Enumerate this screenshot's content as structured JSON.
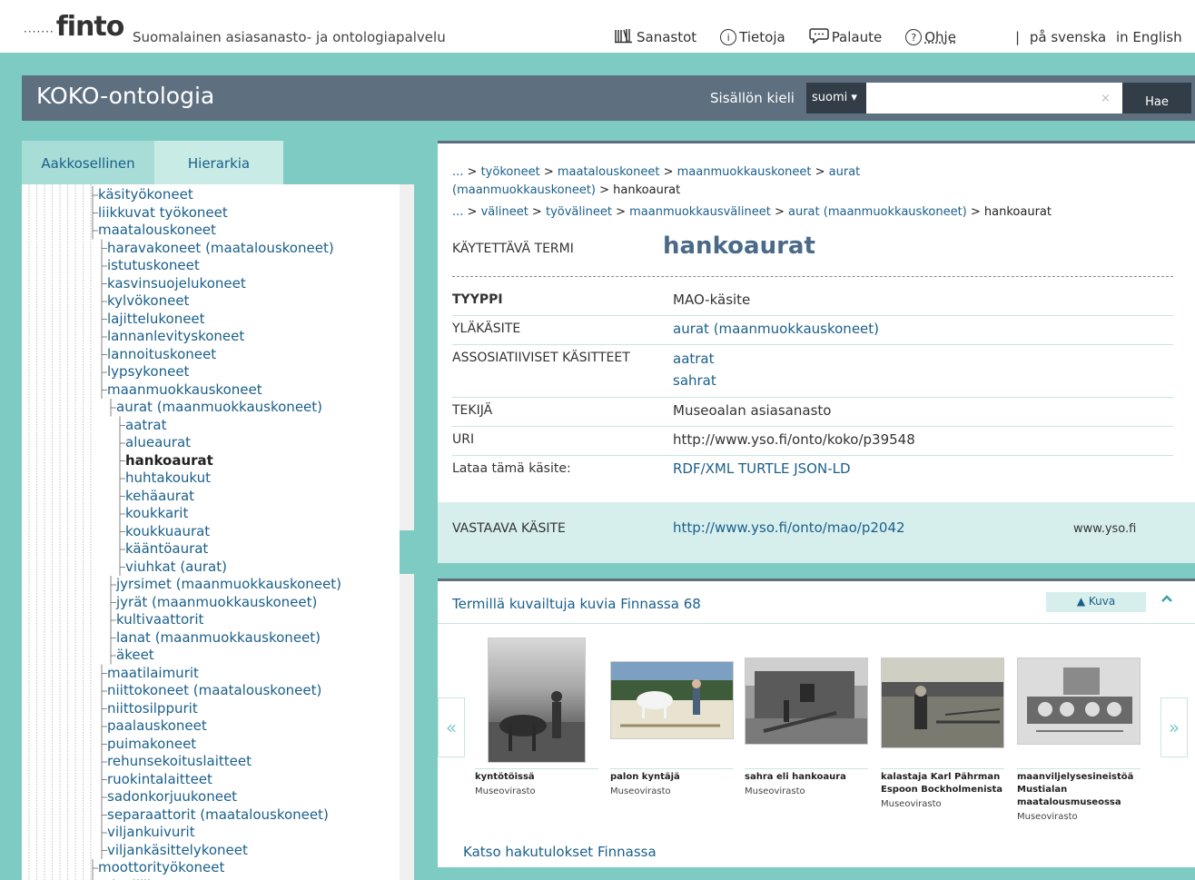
{
  "header": {
    "logo_dots": "·······",
    "logo_word": "finto",
    "tagline": "Suomalainen asiasanasto- ja ontologiapalvelu",
    "nav": [
      {
        "label": "Sanastot",
        "icon": "books-icon"
      },
      {
        "label": "Tietoja",
        "icon": "info-icon"
      },
      {
        "label": "Palaute",
        "icon": "speech-bubble-icon"
      },
      {
        "label": "Ohje",
        "icon": "question-icon"
      }
    ],
    "lang_separator": "|",
    "lang_sv": "på svenska",
    "lang_en": "in English"
  },
  "vocab_bar": {
    "title": "KOKO-ontologia",
    "content_lang_label": "Sisällön kieli",
    "content_lang_value": "suomi ▾",
    "search_value": "",
    "search_clear": "×",
    "search_button": "Hae"
  },
  "sidebar": {
    "tabs": [
      "Aakkosellinen",
      "Hierarkia"
    ],
    "active_tab": "Hierarkia",
    "tree": [
      {
        "label": "käsityökoneet",
        "depth": 0
      },
      {
        "label": "liikkuvat työkoneet",
        "depth": 0
      },
      {
        "label": "maatalouskoneet",
        "depth": 0
      },
      {
        "label": "haravakoneet (maatalouskoneet)",
        "depth": 1
      },
      {
        "label": "istutuskoneet",
        "depth": 1
      },
      {
        "label": "kasvinsuojelukoneet",
        "depth": 1
      },
      {
        "label": "kylvökoneet",
        "depth": 1
      },
      {
        "label": "lajittelukoneet",
        "depth": 1
      },
      {
        "label": "lannanlevityskoneet",
        "depth": 1
      },
      {
        "label": "lannoituskoneet",
        "depth": 1
      },
      {
        "label": "lypsykoneet",
        "depth": 1
      },
      {
        "label": "maanmuokkauskoneet",
        "depth": 1
      },
      {
        "label": "aurat (maanmuokkauskoneet)",
        "depth": 2
      },
      {
        "label": "aatrat",
        "depth": 3
      },
      {
        "label": "alueaurat",
        "depth": 3
      },
      {
        "label": "hankoaurat",
        "depth": 3,
        "current": true
      },
      {
        "label": "huhtakoukut",
        "depth": 3
      },
      {
        "label": "kehäaurat",
        "depth": 3
      },
      {
        "label": "koukkarit",
        "depth": 3
      },
      {
        "label": "koukkuaurat",
        "depth": 3
      },
      {
        "label": "kääntöaurat",
        "depth": 3
      },
      {
        "label": "viuhkat (aurat)",
        "depth": 3
      },
      {
        "label": "jyrsimet (maanmuokkauskoneet)",
        "depth": 2
      },
      {
        "label": "jyrät (maanmuokkauskoneet)",
        "depth": 2
      },
      {
        "label": "kultivaattorit",
        "depth": 2
      },
      {
        "label": "lanat (maanmuokkauskoneet)",
        "depth": 2
      },
      {
        "label": "äkeet",
        "depth": 2
      },
      {
        "label": "maatilaimurit",
        "depth": 1
      },
      {
        "label": "niittokoneet (maatalouskoneet)",
        "depth": 1
      },
      {
        "label": "niittosilppurit",
        "depth": 1
      },
      {
        "label": "paalauskoneet",
        "depth": 1
      },
      {
        "label": "puimakoneet",
        "depth": 1
      },
      {
        "label": "rehunsekoituslaitteet",
        "depth": 1
      },
      {
        "label": "ruokintalaitteet",
        "depth": 1
      },
      {
        "label": "sadonkorjuukoneet",
        "depth": 1
      },
      {
        "label": "separaattorit (maatalouskoneet)",
        "depth": 1
      },
      {
        "label": "viljankuivurit",
        "depth": 1
      },
      {
        "label": "viljankäsittelykoneet",
        "depth": 1
      },
      {
        "label": "moottorityökoneet",
        "depth": 0
      },
      {
        "label": "tekstiilikoneet",
        "depth": 0
      }
    ]
  },
  "concept": {
    "breadcrumb1": [
      {
        "label": "...",
        "link": true
      },
      {
        "label": "työkoneet",
        "link": true
      },
      {
        "label": "maatalouskoneet",
        "link": true
      },
      {
        "label": "maanmuokkauskoneet",
        "link": true
      },
      {
        "label": "aurat (maanmuokkauskoneet)",
        "link": true
      },
      {
        "label": "hankoaurat",
        "link": false
      }
    ],
    "breadcrumb2": [
      {
        "label": "...",
        "link": true
      },
      {
        "label": "välineet",
        "link": true
      },
      {
        "label": "työvälineet",
        "link": true
      },
      {
        "label": "maanmuokkausvälineet",
        "link": true
      },
      {
        "label": "aurat (maanmuokkauskoneet)",
        "link": true
      },
      {
        "label": "hankoaurat",
        "link": false
      }
    ],
    "pref_label_title": "KÄYTETTÄVÄ TERMI",
    "pref_label": "hankoaurat",
    "props": {
      "type_label": "TYYPPI",
      "type_value": "MAO-käsite",
      "broader_label": "YLÄKÄSITE",
      "broader_value": "aurat (maanmuokkauskoneet)",
      "related_label": "ASSOSIATIIVISET KÄSITTEET",
      "related_1": "aatrat",
      "related_2": "sahrat",
      "creator_label": "TEKIJÄ",
      "creator_value": "Museoalan asiasanasto",
      "uri_label": "URI",
      "uri_value": "http://www.yso.fi/onto/koko/p39548",
      "download_label": "Lataa tämä käsite:",
      "download_value": "RDF/XML TURTLE JSON-LD"
    },
    "mapping": {
      "label": "VASTAAVA KÄSITE",
      "uri": "http://www.yso.fi/onto/mao/p2042",
      "site": "www.yso.fi"
    }
  },
  "finna": {
    "heading": "Termillä kuvailtuja kuvia Finnassa 68",
    "kuva_button": "▲ Kuva",
    "collapse_icon": "^",
    "prev": "«",
    "next": "»",
    "pictures": [
      {
        "title": "kyntötöissä",
        "org": "Museovirasto"
      },
      {
        "title": "palon kyntäjä",
        "org": "Museovirasto"
      },
      {
        "title": "sahra eli hankoaura",
        "org": "Museovirasto"
      },
      {
        "title": "kalastaja Karl Pährman Espoon Bockholmenista",
        "org": "Museovirasto"
      },
      {
        "title": "maanviljelysesineistöä Mustialan maatalousmuseossa",
        "org": "Museovirasto"
      }
    ],
    "see_results": "Katso hakutulokset Finnassa"
  },
  "colors": {
    "teal": "#7ecbc4",
    "header_bar": "#5e6f80",
    "dark_button": "#333d47",
    "link": "#1a5f8a"
  }
}
